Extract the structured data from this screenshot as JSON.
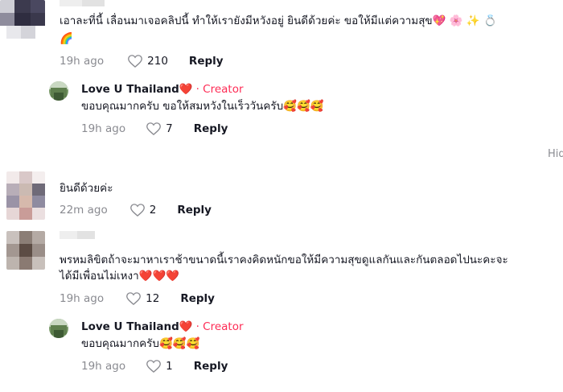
{
  "comments": [
    {
      "text": "เอาละที่นี้ เลื่อนมาเจอคลิปนี้ ทำให้เรายังมีหวังอยู่ ยินดีด้วยค่ะ ขอให้มีแต่ความสุข",
      "emojis": "💖 🌸 ✨ 💍",
      "emojis_line2": "🌈",
      "time": "19h ago",
      "likes": "210",
      "reply_label": "Reply",
      "reply": {
        "username": "Love U Thailand❤️",
        "creator_label": "· Creator",
        "text": "ขอบคุณมากครับ ขอให้สมหวังในเร็ววันครับ🥰🥰🥰",
        "time": "19h ago",
        "likes": "7",
        "reply_label": "Reply"
      }
    },
    {
      "text": "ยินดีด้วยค่ะ",
      "time": "22m ago",
      "likes": "2",
      "reply_label": "Reply"
    },
    {
      "text": "พรหมลิขิตถ้าจะมาหาเราช้าขนาดนี้เราคงคิดหนักขอให้มีความสุขดูแลกันและกันตลอดไปนะคะจะ",
      "text_line2": "ได้มีเพื่อนไม่เหงา❤️❤️❤️",
      "time": "19h ago",
      "likes": "12",
      "reply_label": "Reply",
      "reply": {
        "username": "Love U Thailand❤️",
        "creator_label": "· Creator",
        "text": "ขอบคุณมากครับ🥰🥰🥰",
        "time": "19h ago",
        "likes": "1",
        "reply_label": "Reply"
      }
    }
  ],
  "hide_label": "Hid"
}
